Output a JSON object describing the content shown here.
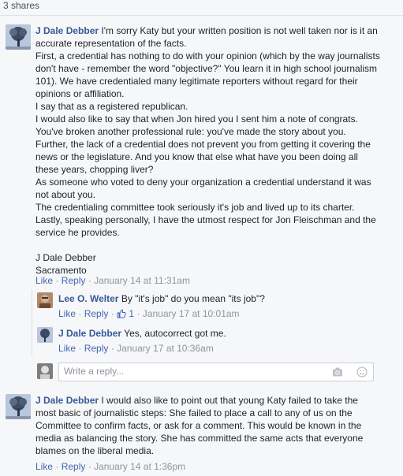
{
  "shares": "3 shares",
  "sep": "·",
  "comments": [
    {
      "author": "J Dale Debber",
      "paragraphs": [
        "I'm sorry Katy but your written position is not well taken nor is it an accurate representation of the facts.",
        "First, a credential has nothing to do with your opinion (which by the way journalists don't have - remember the word \"objective?\" You learn it in high school journalism 101). We have credentialed many legitimate reporters without regard for their opinions or affiliation.",
        "I say that as a registered republican.",
        "I would also like to say that when Jon hired you I sent him a note of congrats. You've broken another professional rule: you've made the story about you.",
        "Further, the lack of a credential does not prevent you from getting it covering the news or the legislature. And you know that else what have you been doing all these years, chopping liver?",
        "As someone who voted to deny your organization a credential understand it was not about you.",
        "The credentialing committee took seriously it's job and lived up to its charter.",
        "Lastly, speaking personally, I have the utmost respect for Jon Fleischman and the service he provides."
      ],
      "signature_name": "J Dale Debber",
      "signature_place": "Sacramento",
      "like": "Like",
      "reply": "Reply",
      "time": "January 14 at 11:31am"
    },
    {
      "author": "Lee O. Welter",
      "text": "By \"it's job\" do you mean \"its job\"?",
      "like": "Like",
      "reply": "Reply",
      "likes_count": "1",
      "time": "January 17 at 10:01am"
    },
    {
      "author": "J Dale Debber",
      "text": "Yes, autocorrect got me.",
      "like": "Like",
      "reply": "Reply",
      "time": "January 17 at 10:36am"
    },
    {
      "author": "J Dale Debber",
      "text": "I would also like to point out that young Katy failed to take the most basic of journalistic steps: She failed to place a call to any of us on the Committee to confirm facts, or ask for a comment. This would be known in the media as balancing the story. She has committed the same acts that everyone blames on the liberal media.",
      "like": "Like",
      "reply": "Reply",
      "time": "January 14 at 1:36pm"
    }
  ],
  "reply_box": {
    "placeholder": "Write a reply...",
    "camera_icon": "camera-icon",
    "emoji_icon": "emoji-icon"
  },
  "colors": {
    "link": "#4267b2",
    "name": "#365899",
    "meta": "#90949c",
    "background": "#f6f7f9"
  }
}
